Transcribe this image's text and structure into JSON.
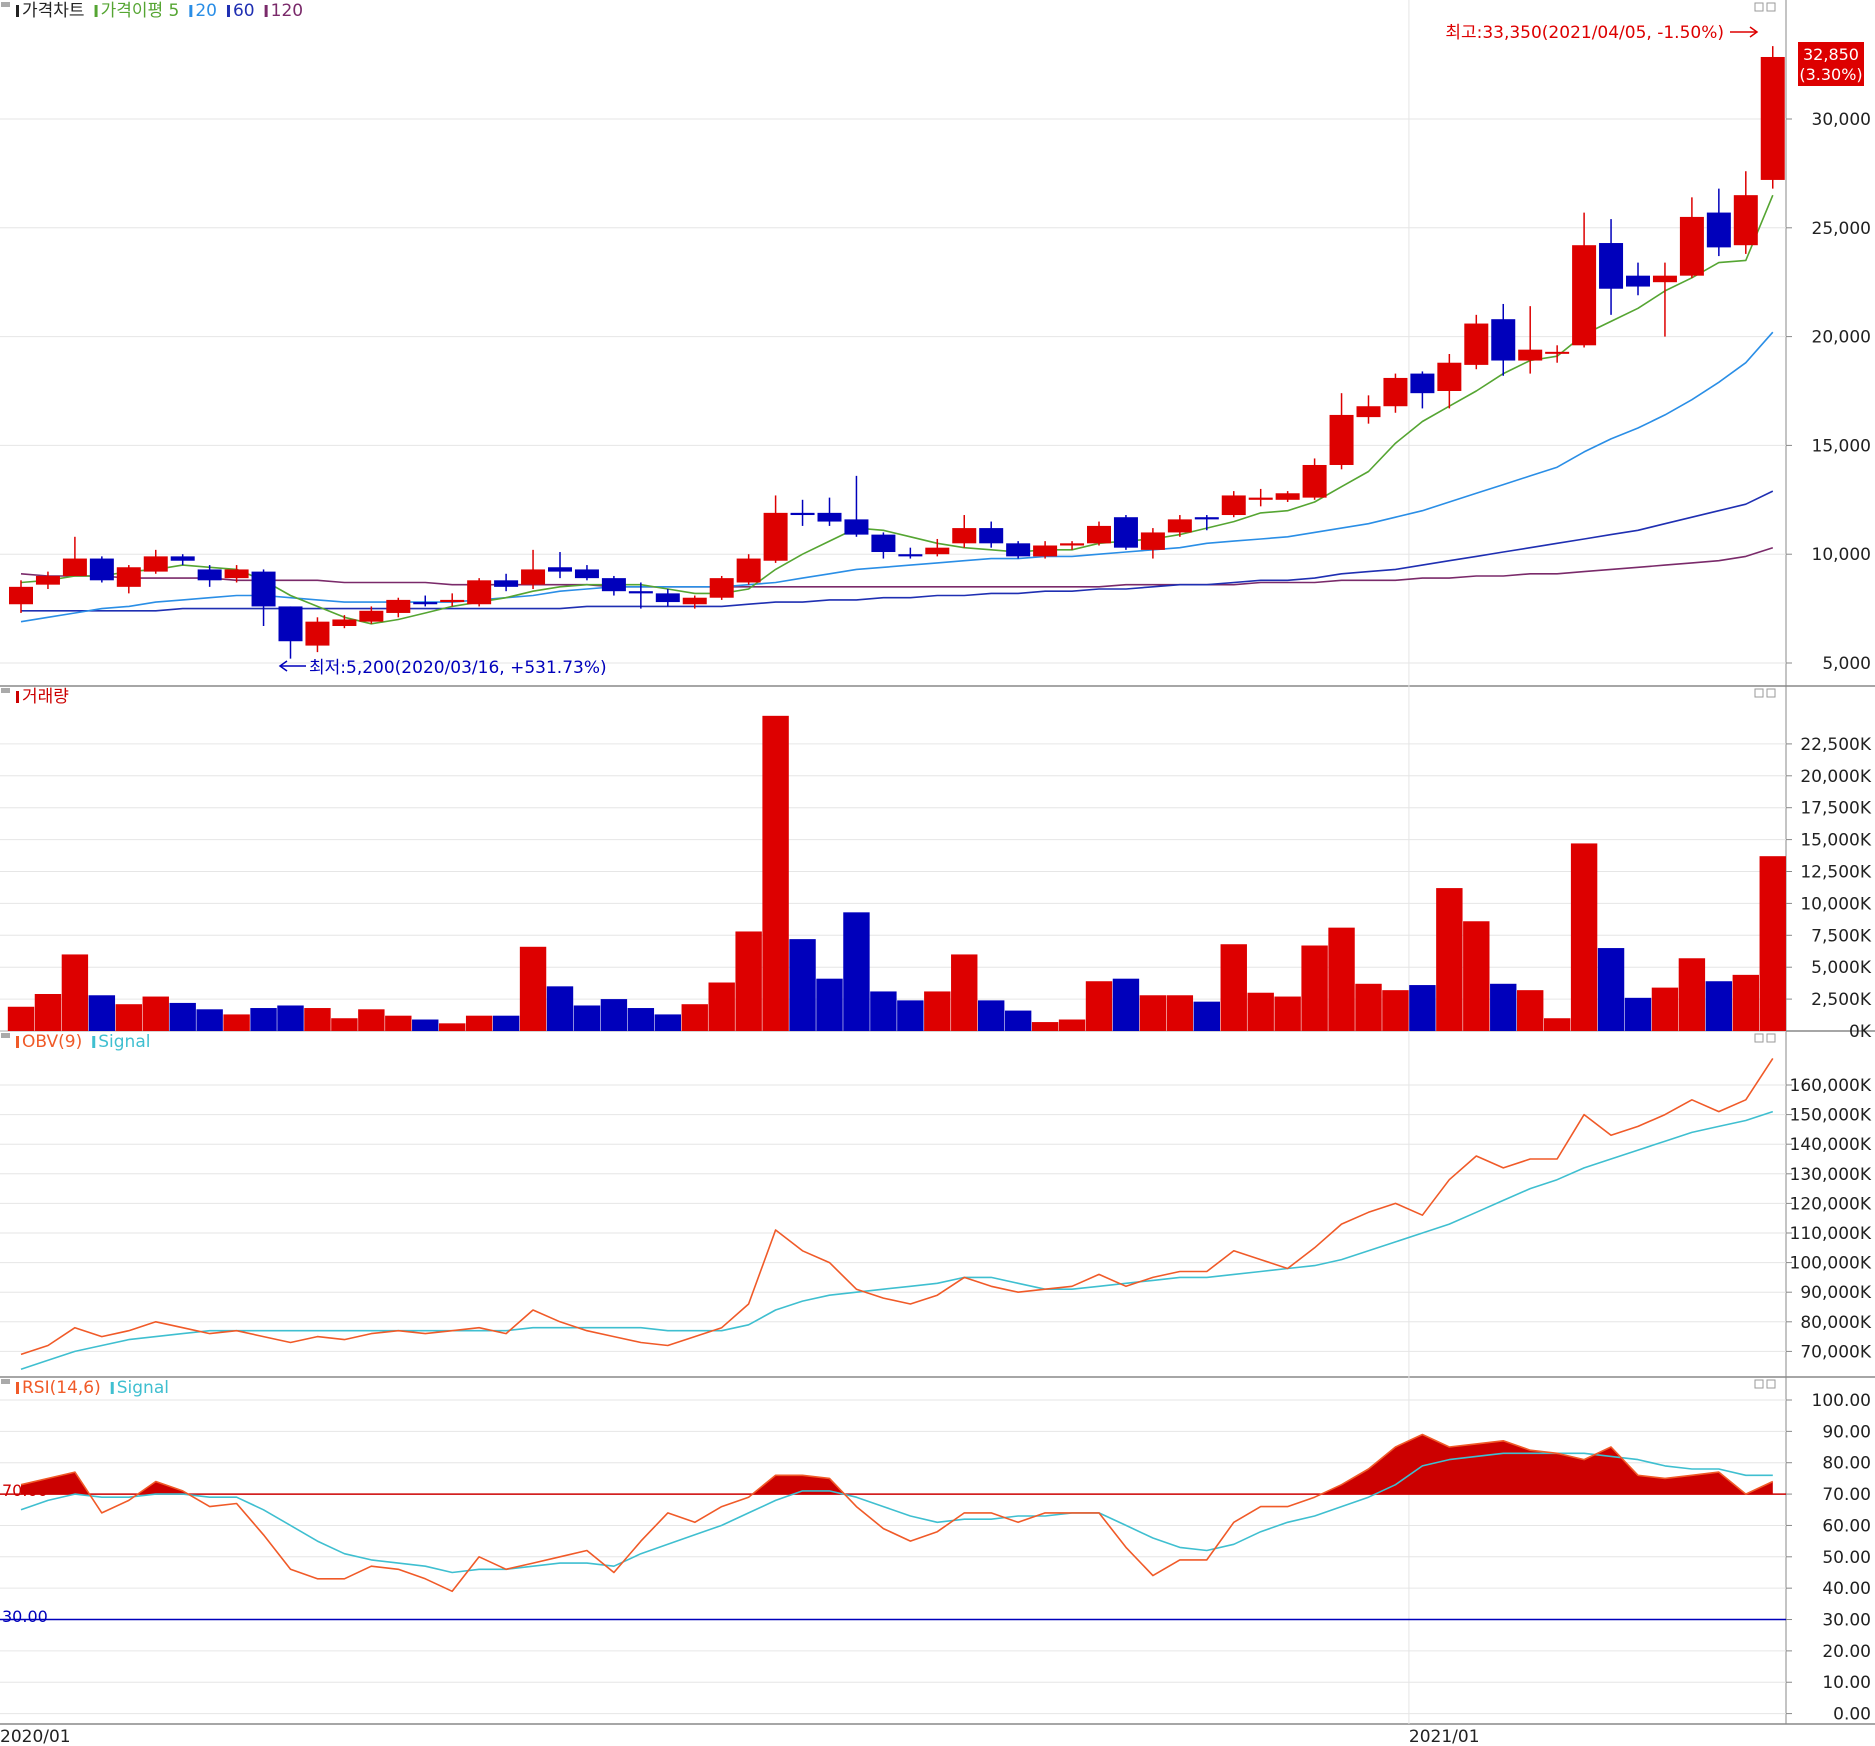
{
  "panels": {
    "price": {
      "legend": [
        {
          "text": "가격차트",
          "color": "#222222"
        },
        {
          "text": "가격이평 5",
          "color": "#55a532"
        },
        {
          "text": "20",
          "color": "#2a8ee6"
        },
        {
          "text": "60",
          "color": "#1f2fb2"
        },
        {
          "text": "120",
          "color": "#7a2a6a"
        }
      ],
      "high_label": "최고:33,350(2021/04/05, -1.50%)",
      "low_label": "최저:5,200(2020/03/16, +531.73%)",
      "last_price": "32,850",
      "last_change": "(3.30%)",
      "axis_ticks": [
        "30,000",
        "25,000",
        "20,000",
        "15,000",
        "10,000",
        "5,000"
      ]
    },
    "volume": {
      "legend": [
        {
          "text": "거래량",
          "color": "#cc0000"
        }
      ],
      "axis_ticks": [
        "22,500K",
        "20,000K",
        "17,500K",
        "15,000K",
        "12,500K",
        "10,000K",
        "7,500K",
        "5,000K",
        "2,500K",
        "0K"
      ]
    },
    "obv": {
      "legend": [
        {
          "text": "OBV(9)",
          "color": "#f05a28"
        },
        {
          "text": "Signal",
          "color": "#3fbfd0"
        }
      ],
      "axis_ticks": [
        "160,000K",
        "150,000K",
        "140,000K",
        "130,000K",
        "120,000K",
        "110,000K",
        "100,000K",
        "90,000K",
        "80,000K",
        "70,000K"
      ]
    },
    "rsi": {
      "legend": [
        {
          "text": "RSI(14,6)",
          "color": "#f05a28"
        },
        {
          "text": "Signal",
          "color": "#3fbfd0"
        }
      ],
      "upper_label": "70.00",
      "lower_label": "30.00",
      "axis_ticks": [
        "100.00",
        "90.00",
        "80.00",
        "70.00",
        "60.00",
        "50.00",
        "40.00",
        "30.00",
        "20.00",
        "10.00",
        "0.00"
      ]
    }
  },
  "x_axis_labels": [
    {
      "text": "2020/01",
      "index": 0
    },
    {
      "text": "2021/01",
      "index": 52
    }
  ],
  "colors": {
    "up": "#dd0000",
    "down": "#0000bb",
    "ma5": "#55a532",
    "ma20": "#2a8ee6",
    "ma60": "#1f2fb2",
    "ma120": "#7a2a6a",
    "obv": "#f05a28",
    "signal": "#3fbfd0",
    "rsi_fill": "#cc0000"
  },
  "chart_data": [
    {
      "type": "candlestick",
      "panel": "price",
      "ylim": [
        4500,
        34000
      ],
      "candles": [
        {
          "o": 7700,
          "h": 8800,
          "l": 7300,
          "c": 8500
        },
        {
          "o": 8600,
          "h": 9200,
          "l": 8400,
          "c": 9000
        },
        {
          "o": 9000,
          "h": 10800,
          "l": 9000,
          "c": 9800
        },
        {
          "o": 9800,
          "h": 9900,
          "l": 8700,
          "c": 8800
        },
        {
          "o": 8500,
          "h": 9500,
          "l": 8200,
          "c": 9400
        },
        {
          "o": 9200,
          "h": 10200,
          "l": 9100,
          "c": 9900
        },
        {
          "o": 9900,
          "h": 10000,
          "l": 9500,
          "c": 9700
        },
        {
          "o": 9300,
          "h": 9500,
          "l": 8500,
          "c": 8800
        },
        {
          "o": 8900,
          "h": 9500,
          "l": 8700,
          "c": 9300
        },
        {
          "o": 9200,
          "h": 9300,
          "l": 6700,
          "c": 7600
        },
        {
          "o": 7600,
          "h": 7600,
          "l": 5200,
          "c": 6000
        },
        {
          "o": 5800,
          "h": 7100,
          "l": 5500,
          "c": 6900
        },
        {
          "o": 6700,
          "h": 7200,
          "l": 6600,
          "c": 7000
        },
        {
          "o": 6900,
          "h": 7600,
          "l": 6800,
          "c": 7400
        },
        {
          "o": 7300,
          "h": 8000,
          "l": 7100,
          "c": 7900
        },
        {
          "o": 7800,
          "h": 8100,
          "l": 7600,
          "c": 7700
        },
        {
          "o": 7800,
          "h": 8200,
          "l": 7600,
          "c": 7900
        },
        {
          "o": 7700,
          "h": 8900,
          "l": 7600,
          "c": 8800
        },
        {
          "o": 8800,
          "h": 9100,
          "l": 8300,
          "c": 8500
        },
        {
          "o": 8600,
          "h": 10200,
          "l": 8400,
          "c": 9300
        },
        {
          "o": 9400,
          "h": 10100,
          "l": 8900,
          "c": 9200
        },
        {
          "o": 9300,
          "h": 9500,
          "l": 8800,
          "c": 8900
        },
        {
          "o": 8900,
          "h": 9000,
          "l": 8100,
          "c": 8300
        },
        {
          "o": 8300,
          "h": 8700,
          "l": 7500,
          "c": 8200
        },
        {
          "o": 8200,
          "h": 8400,
          "l": 7600,
          "c": 7800
        },
        {
          "o": 7700,
          "h": 8100,
          "l": 7500,
          "c": 8000
        },
        {
          "o": 8000,
          "h": 9000,
          "l": 7900,
          "c": 8900
        },
        {
          "o": 8700,
          "h": 10000,
          "l": 8600,
          "c": 9800
        },
        {
          "o": 9700,
          "h": 12700,
          "l": 9600,
          "c": 11900
        },
        {
          "o": 11900,
          "h": 12500,
          "l": 11300,
          "c": 11800
        },
        {
          "o": 11900,
          "h": 12600,
          "l": 11300,
          "c": 11500
        },
        {
          "o": 11600,
          "h": 13600,
          "l": 10800,
          "c": 10900
        },
        {
          "o": 10900,
          "h": 11000,
          "l": 9800,
          "c": 10100
        },
        {
          "o": 10000,
          "h": 10300,
          "l": 9800,
          "c": 9900
        },
        {
          "o": 10000,
          "h": 10700,
          "l": 9900,
          "c": 10300
        },
        {
          "o": 10500,
          "h": 11800,
          "l": 10300,
          "c": 11200
        },
        {
          "o": 11200,
          "h": 11500,
          "l": 10300,
          "c": 10500
        },
        {
          "o": 10500,
          "h": 10600,
          "l": 9800,
          "c": 9900
        },
        {
          "o": 9900,
          "h": 10600,
          "l": 9800,
          "c": 10400
        },
        {
          "o": 10400,
          "h": 10600,
          "l": 10200,
          "c": 10500
        },
        {
          "o": 10500,
          "h": 11500,
          "l": 10400,
          "c": 11300
        },
        {
          "o": 11700,
          "h": 11800,
          "l": 10200,
          "c": 10300
        },
        {
          "o": 10200,
          "h": 11200,
          "l": 9800,
          "c": 11000
        },
        {
          "o": 11000,
          "h": 11800,
          "l": 10800,
          "c": 11600
        },
        {
          "o": 11700,
          "h": 11800,
          "l": 11100,
          "c": 11600
        },
        {
          "o": 11800,
          "h": 12900,
          "l": 11700,
          "c": 12700
        },
        {
          "o": 12500,
          "h": 13000,
          "l": 12200,
          "c": 12600
        },
        {
          "o": 12500,
          "h": 12900,
          "l": 12400,
          "c": 12800
        },
        {
          "o": 12600,
          "h": 14400,
          "l": 12500,
          "c": 14100
        },
        {
          "o": 14100,
          "h": 17400,
          "l": 13900,
          "c": 16400
        },
        {
          "o": 16300,
          "h": 17300,
          "l": 16000,
          "c": 16800
        },
        {
          "o": 16800,
          "h": 18300,
          "l": 16500,
          "c": 18100
        },
        {
          "o": 18300,
          "h": 18400,
          "l": 16700,
          "c": 17400
        },
        {
          "o": 17500,
          "h": 19200,
          "l": 16700,
          "c": 18800
        },
        {
          "o": 18700,
          "h": 21000,
          "l": 18500,
          "c": 20600
        },
        {
          "o": 20800,
          "h": 21500,
          "l": 18200,
          "c": 18900
        },
        {
          "o": 18900,
          "h": 21400,
          "l": 18300,
          "c": 19400
        },
        {
          "o": 19300,
          "h": 19600,
          "l": 18800,
          "c": 19300
        },
        {
          "o": 19600,
          "h": 25700,
          "l": 19500,
          "c": 24200
        },
        {
          "o": 24300,
          "h": 25400,
          "l": 21000,
          "c": 22200
        },
        {
          "o": 22800,
          "h": 23400,
          "l": 21900,
          "c": 22300
        },
        {
          "o": 22500,
          "h": 23400,
          "l": 20000,
          "c": 22800
        },
        {
          "o": 22800,
          "h": 26400,
          "l": 22700,
          "c": 25500
        },
        {
          "o": 25700,
          "h": 26800,
          "l": 23700,
          "c": 24100
        },
        {
          "o": 24200,
          "h": 27600,
          "l": 23800,
          "c": 26500
        },
        {
          "o": 27200,
          "h": 33350,
          "l": 26800,
          "c": 32850
        }
      ],
      "ma5": [
        8700,
        8800,
        9000,
        9000,
        9200,
        9300,
        9500,
        9400,
        9300,
        8800,
        8100,
        7600,
        7100,
        6800,
        7000,
        7300,
        7600,
        7800,
        8000,
        8300,
        8500,
        8600,
        8600,
        8600,
        8400,
        8200,
        8200,
        8400,
        9300,
        10000,
        10600,
        11200,
        11100,
        10800,
        10500,
        10300,
        10200,
        10100,
        10200,
        10200,
        10500,
        10600,
        10700,
        10900,
        11200,
        11500,
        11900,
        12000,
        12400,
        13100,
        13800,
        15100,
        16100,
        16800,
        17500,
        18300,
        18900,
        19100,
        20100,
        20700,
        21300,
        22100,
        22700,
        23400,
        23500,
        26500
      ],
      "ma20": [
        6900,
        7100,
        7300,
        7500,
        7600,
        7800,
        7900,
        8000,
        8100,
        8100,
        8000,
        7900,
        7800,
        7800,
        7800,
        7800,
        7800,
        7900,
        8000,
        8100,
        8300,
        8400,
        8500,
        8500,
        8500,
        8500,
        8500,
        8600,
        8700,
        8900,
        9100,
        9300,
        9400,
        9500,
        9600,
        9700,
        9800,
        9800,
        9900,
        9900,
        10000,
        10100,
        10200,
        10300,
        10500,
        10600,
        10700,
        10800,
        11000,
        11200,
        11400,
        11700,
        12000,
        12400,
        12800,
        13200,
        13600,
        14000,
        14700,
        15300,
        15800,
        16400,
        17100,
        17900,
        18800,
        20200
      ],
      "ma60": [
        7400,
        7400,
        7400,
        7400,
        7400,
        7400,
        7500,
        7500,
        7500,
        7500,
        7500,
        7500,
        7500,
        7500,
        7500,
        7500,
        7500,
        7500,
        7500,
        7500,
        7500,
        7600,
        7600,
        7600,
        7600,
        7600,
        7600,
        7700,
        7800,
        7800,
        7900,
        7900,
        8000,
        8000,
        8100,
        8100,
        8200,
        8200,
        8300,
        8300,
        8400,
        8400,
        8500,
        8600,
        8600,
        8700,
        8800,
        8800,
        8900,
        9100,
        9200,
        9300,
        9500,
        9700,
        9900,
        10100,
        10300,
        10500,
        10700,
        10900,
        11100,
        11400,
        11700,
        12000,
        12300,
        12900
      ],
      "ma120": [
        9100,
        9000,
        9000,
        9000,
        8900,
        8900,
        8900,
        8900,
        8800,
        8800,
        8800,
        8800,
        8700,
        8700,
        8700,
        8700,
        8600,
        8600,
        8600,
        8600,
        8600,
        8600,
        8500,
        8500,
        8500,
        8500,
        8500,
        8500,
        8500,
        8500,
        8500,
        8500,
        8500,
        8500,
        8500,
        8500,
        8500,
        8500,
        8500,
        8500,
        8500,
        8600,
        8600,
        8600,
        8600,
        8600,
        8700,
        8700,
        8700,
        8800,
        8800,
        8800,
        8900,
        8900,
        9000,
        9000,
        9100,
        9100,
        9200,
        9300,
        9400,
        9500,
        9600,
        9700,
        9900,
        10300
      ]
    },
    {
      "type": "bar",
      "panel": "volume",
      "unit": "K",
      "ylim": [
        0,
        25000
      ],
      "values": [
        1900,
        2900,
        6000,
        2800,
        2100,
        2700,
        2200,
        1700,
        1300,
        1800,
        2000,
        1800,
        1000,
        1700,
        1200,
        900,
        600,
        1200,
        1200,
        6600,
        3500,
        2000,
        2500,
        1800,
        1300,
        2100,
        3800,
        7800,
        24700,
        7200,
        4100,
        9300,
        3100,
        2400,
        3100,
        6000,
        2400,
        1600,
        700,
        900,
        3900,
        4100,
        2800,
        2800,
        2300,
        6800,
        3000,
        2700,
        6700,
        8100,
        3700,
        3200,
        3600,
        11200,
        8600,
        3700,
        3200,
        1000,
        14700,
        6500,
        2600,
        3400,
        5700,
        3900,
        4400,
        13700
      ]
    },
    {
      "type": "line",
      "panel": "obv",
      "unit": "K",
      "ylim": [
        65000,
        167000
      ],
      "series": [
        {
          "name": "OBV(9)",
          "values": [
            69000,
            72000,
            78000,
            75000,
            77000,
            80000,
            78000,
            76000,
            77000,
            75000,
            73000,
            75000,
            74000,
            76000,
            77000,
            76000,
            77000,
            78000,
            76000,
            84000,
            80000,
            77000,
            75000,
            73000,
            72000,
            75000,
            78000,
            86000,
            111000,
            104000,
            100000,
            91000,
            88000,
            86000,
            89000,
            95000,
            92000,
            90000,
            91000,
            92000,
            96000,
            92000,
            95000,
            97000,
            97000,
            104000,
            101000,
            98000,
            105000,
            113000,
            117000,
            120000,
            116000,
            128000,
            136000,
            132000,
            135000,
            135000,
            150000,
            143000,
            146000,
            150000,
            155000,
            151000,
            155000,
            169000
          ]
        },
        {
          "name": "Signal",
          "values": [
            64000,
            67000,
            70000,
            72000,
            74000,
            75000,
            76000,
            77000,
            77000,
            77000,
            77000,
            77000,
            77000,
            77000,
            77000,
            77000,
            77000,
            77000,
            77000,
            78000,
            78000,
            78000,
            78000,
            78000,
            77000,
            77000,
            77000,
            79000,
            84000,
            87000,
            89000,
            90000,
            91000,
            92000,
            93000,
            95000,
            95000,
            93000,
            91000,
            91000,
            92000,
            93000,
            94000,
            95000,
            95000,
            96000,
            97000,
            98000,
            99000,
            101000,
            104000,
            107000,
            110000,
            113000,
            117000,
            121000,
            125000,
            128000,
            132000,
            135000,
            138000,
            141000,
            144000,
            146000,
            148000,
            151000
          ]
        }
      ]
    },
    {
      "type": "line",
      "panel": "rsi",
      "ylim": [
        0,
        100
      ],
      "hlines": [
        70,
        30
      ],
      "series": [
        {
          "name": "RSI(14,6)",
          "values": [
            73,
            75,
            77,
            64,
            68,
            74,
            71,
            66,
            67,
            57,
            46,
            43,
            43,
            47,
            46,
            43,
            39,
            50,
            46,
            48,
            50,
            52,
            45,
            55,
            64,
            61,
            66,
            69,
            76,
            76,
            75,
            66,
            59,
            55,
            58,
            64,
            64,
            61,
            64,
            64,
            64,
            53,
            44,
            49,
            49,
            61,
            66,
            66,
            69,
            73,
            78,
            85,
            89,
            85,
            86,
            87,
            84,
            83,
            81,
            85,
            76,
            75,
            76,
            77,
            70,
            74
          ]
        },
        {
          "name": "Signal",
          "values": [
            65,
            68,
            70,
            69,
            69,
            70,
            70,
            69,
            69,
            65,
            60,
            55,
            51,
            49,
            48,
            47,
            45,
            46,
            46,
            47,
            48,
            48,
            47,
            51,
            54,
            57,
            60,
            64,
            68,
            71,
            71,
            69,
            66,
            63,
            61,
            62,
            62,
            63,
            63,
            64,
            64,
            60,
            56,
            53,
            52,
            54,
            58,
            61,
            63,
            66,
            69,
            73,
            79,
            81,
            82,
            83,
            83,
            83,
            83,
            82,
            81,
            79,
            78,
            78,
            76,
            76
          ]
        }
      ]
    }
  ]
}
